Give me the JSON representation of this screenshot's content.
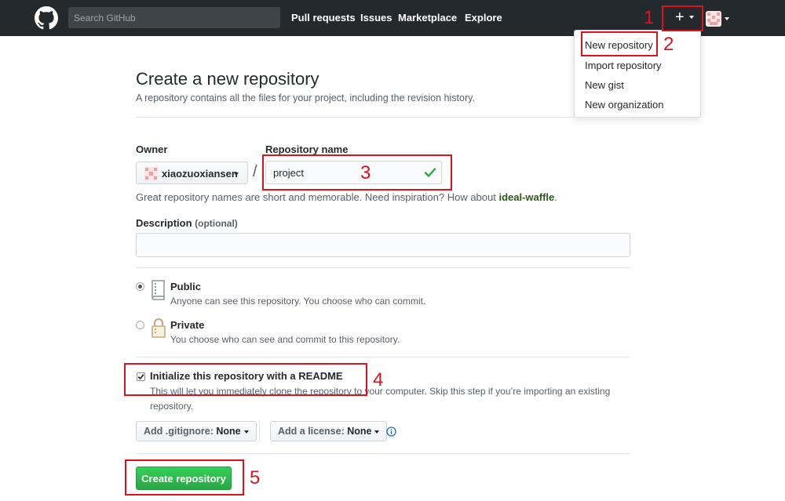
{
  "header": {
    "search_placeholder": "Search GitHub",
    "nav": [
      "Pull requests",
      "Issues",
      "Marketplace",
      "Explore"
    ],
    "plus_label": "+"
  },
  "dropdown": {
    "items": [
      "New repository",
      "Import repository",
      "New gist",
      "New organization"
    ]
  },
  "main": {
    "title": "Create a new repository",
    "subtitle": "A repository contains all the files for your project, including the revision history.",
    "owner_label": "Owner",
    "owner_value": "xiaozuoxiansen",
    "separator": "/",
    "repo_label": "Repository name",
    "repo_value": "project",
    "hint_prefix": "Great repository names are short and memorable. Need inspiration? How about ",
    "hint_suggestion": "ideal-waffle",
    "hint_suffix": ".",
    "description_label": "Description",
    "description_optional": "(optional)",
    "public_title": "Public",
    "public_desc": "Anyone can see this repository. You choose who can commit.",
    "private_title": "Private",
    "private_desc": "You choose who can see and commit to this repository.",
    "readme_title": "Initialize this repository with a README",
    "readme_desc": "This will let you immediately clone the repository to your computer. Skip this step if you’re importing an existing repository.",
    "gitignore_label": "Add .gitignore:",
    "gitignore_value": "None",
    "license_label": "Add a license:",
    "license_value": "None",
    "create_button": "Create repository"
  },
  "annotations": [
    "1",
    "2",
    "3",
    "4",
    "5"
  ],
  "colors": {
    "header_bg": "#24292e",
    "annotation_red": "#d9141e",
    "create_green": "#28a745",
    "valid_check": "#28a745",
    "info_blue": "#0366d6"
  }
}
